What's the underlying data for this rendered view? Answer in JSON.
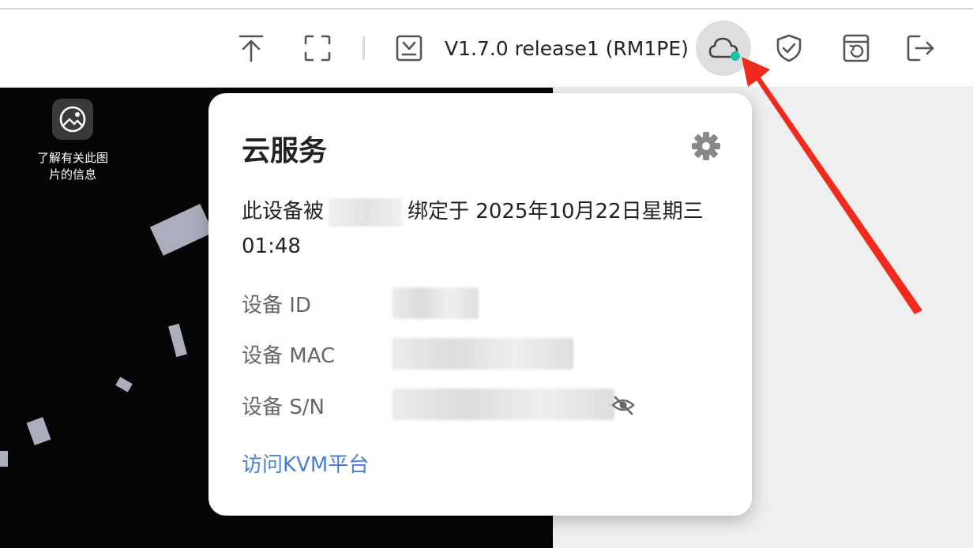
{
  "toolbar": {
    "version": "V1.7.0 release1 (RM1PE)",
    "icons": [
      "upload-icon",
      "fullscreen-icon",
      "download-icon",
      "cloud-icon",
      "shield-check-icon",
      "restore-icon",
      "logout-icon"
    ],
    "cloud_status_color": "#19c2a8"
  },
  "desktop": {
    "lookup_label": "了解有关此图片的信息"
  },
  "cloud_popover": {
    "title": "云服务",
    "bind_prefix": "此设备被",
    "bind_suffix": "绑定于 2025年10月22日星期三 01:48",
    "rows": [
      {
        "label": "设备 ID"
      },
      {
        "label": "设备 MAC"
      },
      {
        "label": "设备 S/N"
      }
    ],
    "link": "访问KVM平台",
    "link_color": "#4a7dd6"
  },
  "annotation": {
    "arrow_color": "#f02a1c"
  }
}
